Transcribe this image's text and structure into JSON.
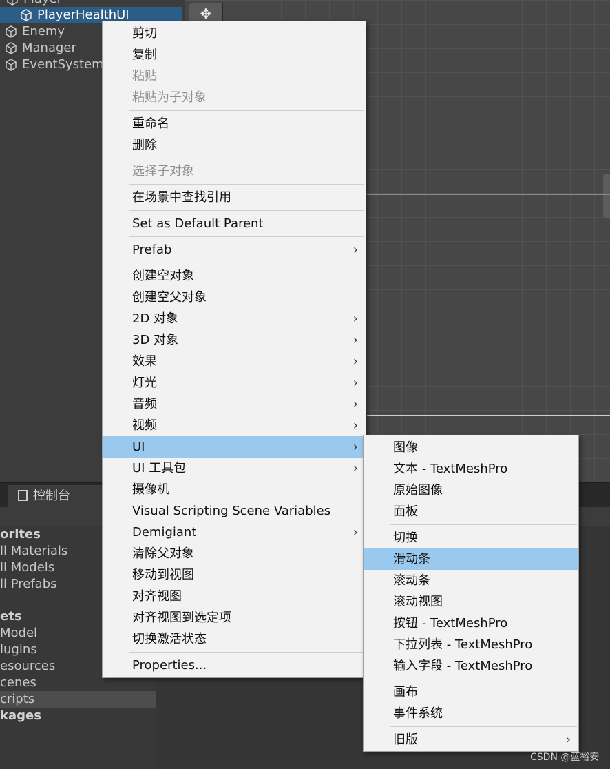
{
  "hierarchy": {
    "items": [
      {
        "label": "Player"
      },
      {
        "label": "PlayerHealthUI"
      },
      {
        "label": "Enemy"
      },
      {
        "label": "Manager"
      },
      {
        "label": "EventSystem"
      }
    ]
  },
  "scene": {
    "move_tool_icon": "move-arrows-icon",
    "move_tool_glyph": "✥"
  },
  "console": {
    "tab_label": "控制台"
  },
  "project": {
    "items": [
      {
        "label": "orites"
      },
      {
        "label": "ll Materials"
      },
      {
        "label": "ll Models"
      },
      {
        "label": "ll Prefabs"
      },
      {
        "label": "ets"
      },
      {
        "label": "Model"
      },
      {
        "label": "lugins"
      },
      {
        "label": "esources"
      },
      {
        "label": "cenes"
      },
      {
        "label": "cripts"
      },
      {
        "label": "kages"
      }
    ]
  },
  "menu": {
    "items": [
      {
        "label": "剪切"
      },
      {
        "label": "复制"
      },
      {
        "label": "粘贴"
      },
      {
        "label": "粘贴为子对象"
      },
      {
        "label": "重命名"
      },
      {
        "label": "删除"
      },
      {
        "label": "选择子对象"
      },
      {
        "label": "在场景中查找引用"
      },
      {
        "label": "Set as Default Parent"
      },
      {
        "label": "Prefab"
      },
      {
        "label": "创建空对象"
      },
      {
        "label": "创建空父对象"
      },
      {
        "label": "2D 对象"
      },
      {
        "label": "3D 对象"
      },
      {
        "label": "效果"
      },
      {
        "label": "灯光"
      },
      {
        "label": "音频"
      },
      {
        "label": "视频"
      },
      {
        "label": "UI"
      },
      {
        "label": "UI 工具包"
      },
      {
        "label": "摄像机"
      },
      {
        "label": "Visual Scripting Scene Variables"
      },
      {
        "label": "Demigiant"
      },
      {
        "label": "清除父对象"
      },
      {
        "label": "移动到视图"
      },
      {
        "label": "对齐视图"
      },
      {
        "label": "对齐视图到选定项"
      },
      {
        "label": "切换激活状态"
      },
      {
        "label": "Properties..."
      }
    ],
    "arrow_glyph": "›"
  },
  "submenu": {
    "items": [
      {
        "label": "图像"
      },
      {
        "label": "文本 - TextMeshPro"
      },
      {
        "label": "原始图像"
      },
      {
        "label": "面板"
      },
      {
        "label": "切换"
      },
      {
        "label": "滑动条"
      },
      {
        "label": "滚动条"
      },
      {
        "label": "滚动视图"
      },
      {
        "label": "按钮 - TextMeshPro"
      },
      {
        "label": "下拉列表 - TextMeshPro"
      },
      {
        "label": "输入字段 - TextMeshPro"
      },
      {
        "label": "画布"
      },
      {
        "label": "事件系统"
      },
      {
        "label": "旧版"
      }
    ]
  },
  "watermark": "CSDN @蓝裕安",
  "colors": {
    "highlight": "#99c9ef",
    "selected_hierarchy": "#2c5d87",
    "menu_bg": "#f2f2f2",
    "editor_bg": "#383838"
  }
}
